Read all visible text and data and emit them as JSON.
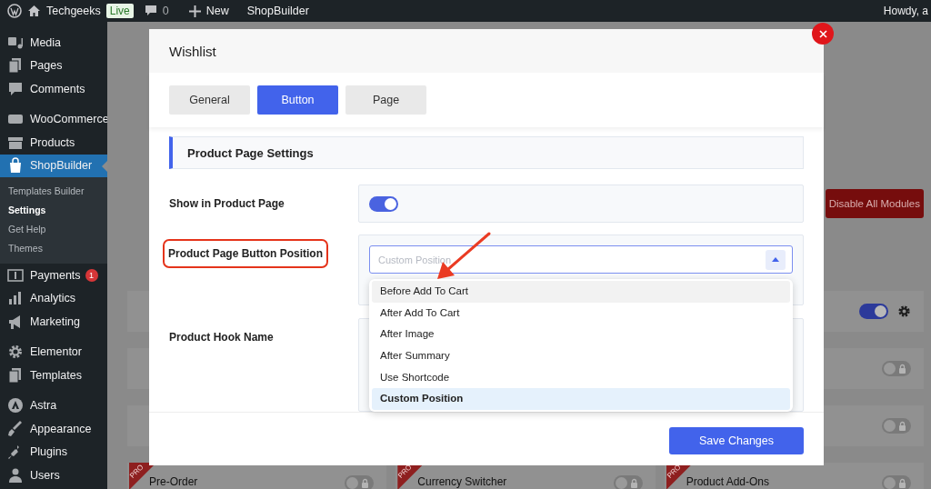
{
  "admin_bar": {
    "site": "Techgeeks",
    "badge": "Live",
    "comments": "0",
    "new": "New",
    "plugin": "ShopBuilder",
    "greeting": "Howdy, a"
  },
  "sidebar": {
    "groups": [
      [
        {
          "label": "Media",
          "selected": false
        },
        {
          "label": "Pages",
          "selected": false
        },
        {
          "label": "Comments",
          "selected": false
        }
      ],
      [
        {
          "label": "WooCommerce",
          "selected": false
        },
        {
          "label": "Products",
          "selected": false
        },
        {
          "label": "ShopBuilder",
          "selected": true,
          "children": [
            {
              "label": "Templates Builder",
              "selected": false
            },
            {
              "label": "Settings",
              "selected": true
            },
            {
              "label": "Get Help",
              "selected": false
            },
            {
              "label": "Themes",
              "selected": false
            }
          ]
        },
        {
          "label": "Payments",
          "selected": false,
          "badge": "1"
        },
        {
          "label": "Analytics",
          "selected": false
        },
        {
          "label": "Marketing",
          "selected": false
        }
      ],
      [
        {
          "label": "Elementor",
          "selected": false
        },
        {
          "label": "Templates",
          "selected": false
        }
      ],
      [
        {
          "label": "Astra",
          "selected": false
        },
        {
          "label": "Appearance",
          "selected": false
        },
        {
          "label": "Plugins",
          "selected": false
        },
        {
          "label": "Users",
          "selected": false
        }
      ]
    ]
  },
  "background": {
    "disable_button": "Disable All Modules",
    "module_toggles": [
      {
        "on": true,
        "locked": false,
        "settings": true
      },
      {
        "on": false,
        "locked": true,
        "settings": false
      },
      {
        "on": false,
        "locked": true,
        "settings": false
      }
    ],
    "modules": [
      {
        "name": "Pre-Order",
        "badge": "PRO",
        "on": false,
        "locked": true
      },
      {
        "name": "Currency Switcher",
        "badge": "PRO",
        "on": false,
        "locked": true
      },
      {
        "name": "Product Add-Ons",
        "badge": "PRO",
        "on": false,
        "locked": true
      }
    ]
  },
  "modal": {
    "title": "Wishlist",
    "tabs": [
      {
        "label": "General",
        "selected": false
      },
      {
        "label": "Button",
        "selected": true
      },
      {
        "label": "Page",
        "selected": false
      }
    ],
    "section": "Product Page Settings",
    "fields": [
      {
        "kind": "toggle",
        "label": "Show in Product Page",
        "on": true
      },
      {
        "kind": "select",
        "label": "Product Page Button Position",
        "highlighted": true,
        "placeholder": "Custom Position",
        "expanded": true,
        "options": [
          {
            "label": "Before Add To Cart",
            "selected": false,
            "hovered": true
          },
          {
            "label": "After Add To Cart",
            "selected": false,
            "hovered": false
          },
          {
            "label": "After Image",
            "selected": false,
            "hovered": false
          },
          {
            "label": "After Summary",
            "selected": false,
            "hovered": false
          },
          {
            "label": "Use Shortcode",
            "selected": false,
            "hovered": false
          },
          {
            "label": "Custom Position",
            "selected": true,
            "hovered": false
          }
        ]
      },
      {
        "kind": "text",
        "label": "Product Hook Name"
      }
    ],
    "save_button": "Save Changes"
  }
}
